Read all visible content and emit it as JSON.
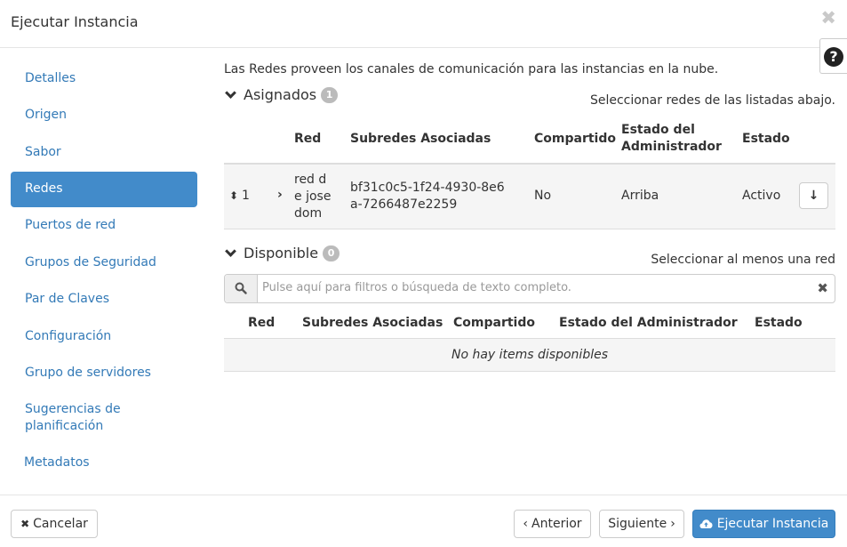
{
  "dialog": {
    "title": "Ejecutar Instancia",
    "close_glyph": "✖",
    "help_glyph": "?"
  },
  "sidebar": {
    "items": [
      {
        "label": "Detalles",
        "active": false
      },
      {
        "label": "Origen",
        "active": false
      },
      {
        "label": "Sabor",
        "active": false
      },
      {
        "label": "Redes",
        "active": true
      },
      {
        "label": "Puertos de red",
        "active": false
      },
      {
        "label": "Grupos de Seguridad",
        "active": false
      },
      {
        "label": "Par de Claves",
        "active": false
      },
      {
        "label": "Configuración",
        "active": false
      },
      {
        "label": "Grupo de servidores",
        "active": false
      },
      {
        "label": "Sugerencias de planificación",
        "active": false
      },
      {
        "label": "Metadatos",
        "active": false
      }
    ]
  },
  "main": {
    "intro": "Las Redes proveen los canales de comunicación para las instancias en la nube.",
    "assigned": {
      "title": "Asignados",
      "count": "1",
      "hint": "Seleccionar redes de las listadas abajo.",
      "columns": {
        "red": "Red",
        "subredes": "Subredes Asociadas",
        "compartido": "Compartido",
        "estado_admin": "Estado del Administrador",
        "estado": "Estado"
      },
      "rows": [
        {
          "order": "1",
          "red": "red de josedom",
          "subredes": "bf31c0c5-1f24-4930-8e6a-7266487e2259",
          "compartido": "No",
          "estado_admin": "Arriba",
          "estado": "Activo"
        }
      ]
    },
    "available": {
      "title": "Disponible",
      "count": "0",
      "hint": "Seleccionar al menos una red",
      "search_placeholder": "Pulse aquí para filtros o búsqueda de texto completo.",
      "columns": {
        "red": "Red",
        "subredes": "Subredes Asociadas",
        "compartido": "Compartido",
        "estado_admin": "Estado del Administrador",
        "estado": "Estado"
      },
      "empty_text": "No hay items disponibles"
    }
  },
  "footer": {
    "cancel": "Cancelar",
    "back": "Anterior",
    "next": "Siguiente",
    "launch": "Ejecutar Instancia"
  },
  "colors": {
    "accent": "#428bca",
    "link": "#337ab7"
  }
}
